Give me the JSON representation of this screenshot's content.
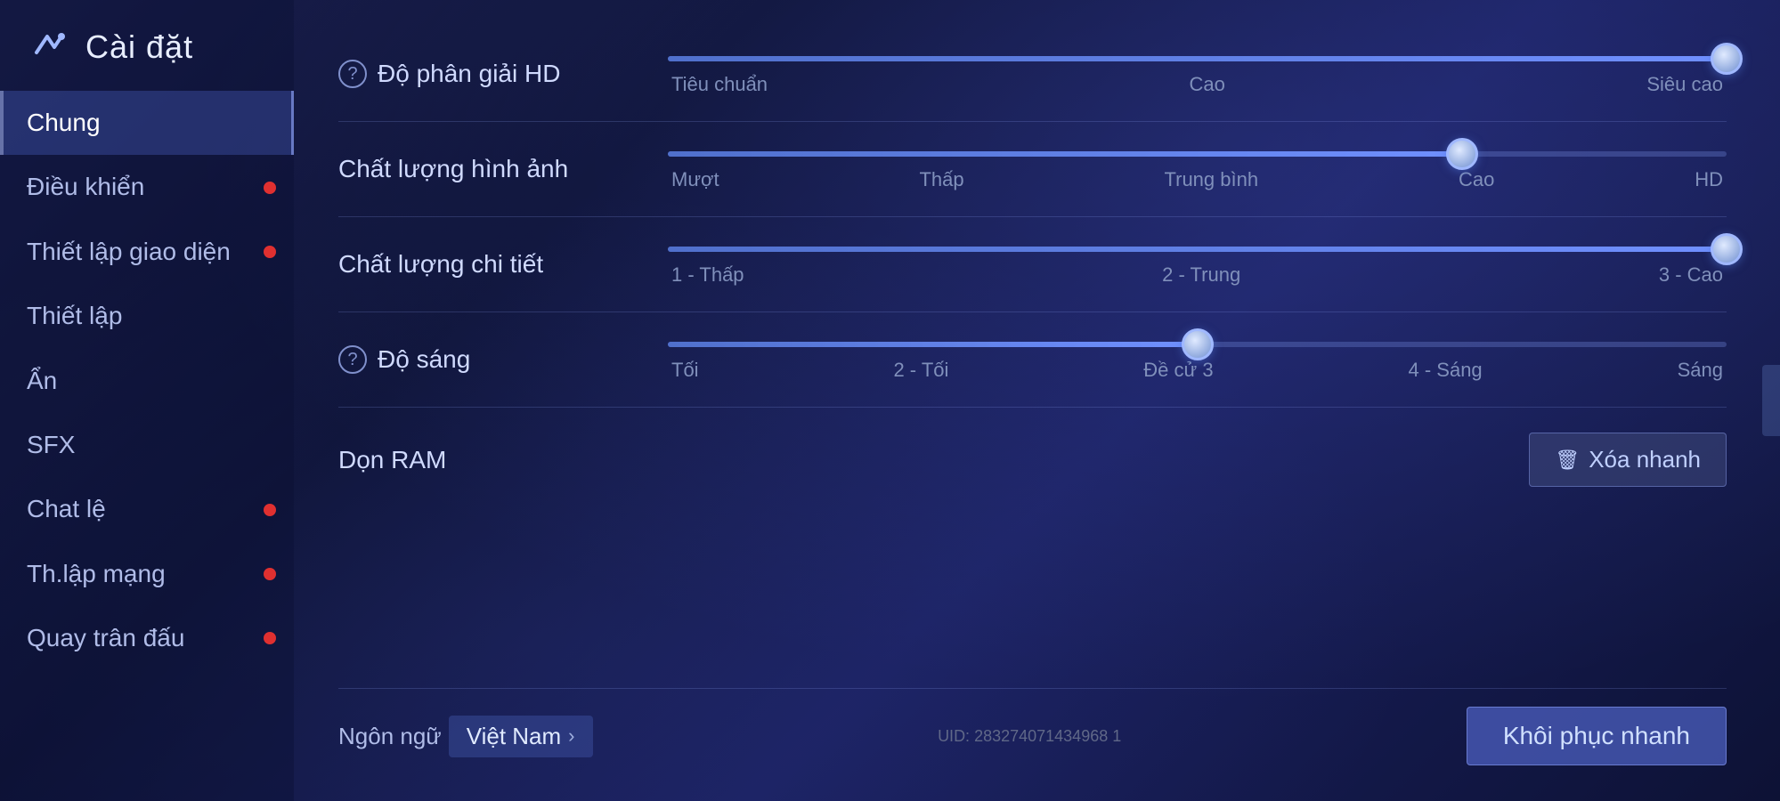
{
  "header": {
    "title": "Cài đặt",
    "logo_alt": "game-logo"
  },
  "sidebar": {
    "items": [
      {
        "id": "chung",
        "label": "Chung",
        "active": true,
        "dot": false
      },
      {
        "id": "dieu-khien",
        "label": "Điều khiển",
        "active": false,
        "dot": true
      },
      {
        "id": "thiet-lap-giao-dien",
        "label": "Thiết lập giao diện",
        "active": false,
        "dot": true
      },
      {
        "id": "thiet-lap",
        "label": "Thiết lập",
        "active": false,
        "dot": false
      },
      {
        "id": "an",
        "label": "Ẩn",
        "active": false,
        "dot": false
      },
      {
        "id": "sfx",
        "label": "SFX",
        "active": false,
        "dot": false
      },
      {
        "id": "chat-le",
        "label": "Chat lệ",
        "active": false,
        "dot": true
      },
      {
        "id": "th-lap-mang",
        "label": "Th.lập mạng",
        "active": false,
        "dot": true
      },
      {
        "id": "quay-tran-dau",
        "label": "Quay trân đấu",
        "active": false,
        "dot": true
      }
    ]
  },
  "settings": {
    "rows": [
      {
        "id": "do-phan-giai",
        "label": "Độ phân giải HD",
        "has_help": true,
        "slider": {
          "fill_pct": 100,
          "thumb_pct": 100,
          "labels": [
            "Tiêu chuẩn",
            "Cao",
            "Siêu cao"
          ]
        },
        "type": "slider"
      },
      {
        "id": "chat-luong-hinh-anh",
        "label": "Chất lượng hình ảnh",
        "has_help": false,
        "slider": {
          "fill_pct": 75,
          "thumb_pct": 75,
          "labels": [
            "Mượt",
            "Thấp",
            "Trung bình",
            "Cao",
            "HD"
          ]
        },
        "type": "slider"
      },
      {
        "id": "chat-luong-chi-tiet",
        "label": "Chất lượng chi tiết",
        "has_help": false,
        "slider": {
          "fill_pct": 100,
          "thumb_pct": 100,
          "labels": [
            "1 - Thấp",
            "2 - Trung",
            "3 - Cao"
          ]
        },
        "type": "slider"
      },
      {
        "id": "do-sang",
        "label": "Độ sáng",
        "has_help": true,
        "slider": {
          "fill_pct": 50,
          "thumb_pct": 50,
          "labels": [
            "Tối",
            "2 - Tối",
            "Đề cử 3",
            "4 - Sáng",
            "Sáng"
          ]
        },
        "type": "slider"
      },
      {
        "id": "don-ram",
        "label": "Dọn RAM",
        "has_help": false,
        "type": "button",
        "button_label": "Xóa nhanh"
      }
    ]
  },
  "bottom": {
    "lang_prefix": "Ngôn ngữ",
    "lang_value": "Việt Nam",
    "uid_label": "UID: 283274071434968 1",
    "restore_button": "Khôi phục nhanh"
  },
  "icons": {
    "help": "?",
    "trash": "🗑",
    "chevron_right": "›"
  }
}
